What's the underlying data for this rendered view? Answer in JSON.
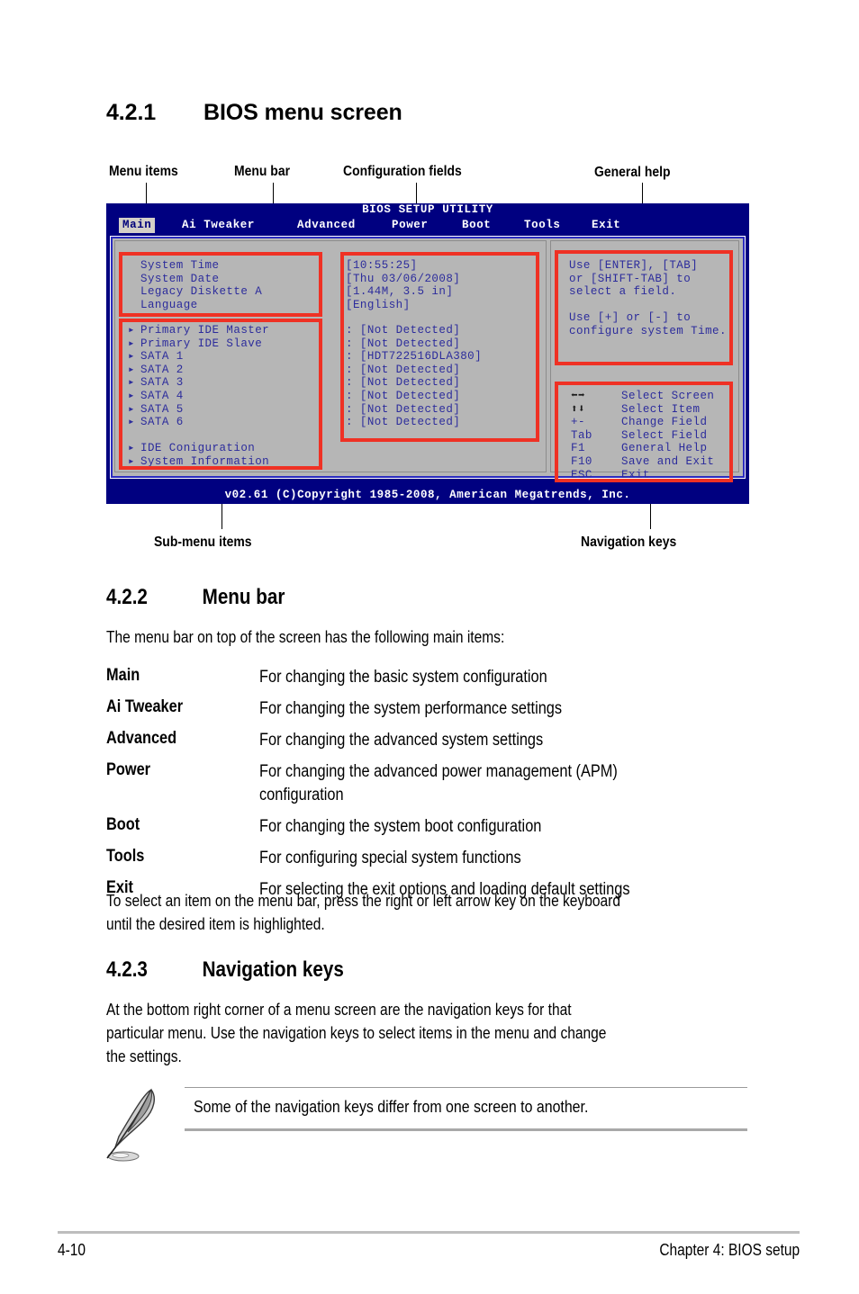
{
  "section_421": {
    "number": "4.2.1",
    "title": "BIOS menu screen"
  },
  "callouts": {
    "menu_items": "Menu items",
    "menu_bar": "Menu bar",
    "configuration_fields": "Configuration fields",
    "general_help": "General help",
    "sub_menu_items": "Sub-menu items",
    "navigation_keys": "Navigation keys"
  },
  "bios": {
    "title": "BIOS SETUP UTILITY",
    "tabs": [
      {
        "label": "Main",
        "active": true
      },
      {
        "label": "Ai Tweaker",
        "active": false
      },
      {
        "label": "Advanced",
        "active": false
      },
      {
        "label": "Power",
        "active": false
      },
      {
        "label": "Boot",
        "active": false
      },
      {
        "label": "Tools",
        "active": false
      },
      {
        "label": "Exit",
        "active": false
      }
    ],
    "menu_items": [
      "System Time",
      "System Date",
      "Legacy Diskette A",
      "Language"
    ],
    "menu_values": [
      "[10:55:25]",
      "[Thu 03/06/2008]",
      "[1.44M, 3.5 in]",
      "[English]"
    ],
    "submenu_items": [
      "Primary IDE Master",
      "Primary IDE Slave",
      "SATA 1",
      "SATA 2",
      "SATA 3",
      "SATA 4",
      "SATA 5",
      "SATA 6"
    ],
    "submenu_values": [
      ": [Not Detected]",
      ": [Not Detected]",
      ": [HDT722516DLA380]",
      ": [Not Detected]",
      ": [Not Detected]",
      ": [Not Detected]",
      ": [Not Detected]",
      ": [Not Detected]"
    ],
    "submenu_items_extra": [
      "IDE Coniguration",
      "System Information"
    ],
    "general_help": "Use [ENTER], [TAB]\nor [SHIFT-TAB] to\nselect a field.\n\nUse [+] or [-] to\nconfigure system Time.",
    "nav_keys": [
      {
        "key": "←→",
        "action": "Select Screen"
      },
      {
        "key": "↑↓",
        "action": "Select Item"
      },
      {
        "key": "+-",
        "action": "Change Field"
      },
      {
        "key": "Tab",
        "action": "Select Field"
      },
      {
        "key": "F1",
        "action": "General Help"
      },
      {
        "key": "F10",
        "action": "Save and Exit"
      },
      {
        "key": "ESC",
        "action": "Exit"
      }
    ],
    "footer": "v02.61 (C)Copyright 1985-2008, American Megatrends, Inc.",
    "colors": {
      "chrome_blue": "#000080",
      "panel_gray": "#b6b6b6",
      "text_blue": "#2c2c9c",
      "annotation_red": "#ef3124"
    }
  },
  "section_422": {
    "number": "4.2.2",
    "title": "Menu bar",
    "intro": "The menu bar on top of the screen has the following main items:",
    "entries": [
      {
        "term": "Main",
        "desc": "For changing the basic system configuration"
      },
      {
        "term": "Ai Tweaker",
        "desc": "For changing the system performance settings"
      },
      {
        "term": "Advanced",
        "desc": "For changing the advanced system settings"
      },
      {
        "term": "Power",
        "desc": "For changing the advanced power management (APM)\nconfiguration"
      },
      {
        "term": "Boot",
        "desc": "For changing the system boot configuration"
      },
      {
        "term": "Tools",
        "desc": "For configuring special system functions"
      },
      {
        "term": "Exit",
        "desc": "For selecting the exit options and loading default settings"
      }
    ],
    "outro": "To select an item on the menu bar, press the right or left arrow key on the keyboard\nuntil the desired item is highlighted."
  },
  "section_423": {
    "number": "4.2.3",
    "title": "Navigation keys",
    "body": "At the bottom right corner of a menu screen are the navigation keys for that\nparticular menu. Use the navigation keys to select items in the menu and change\nthe settings."
  },
  "note": {
    "icon": "quill-pen-icon",
    "text": "Some of the navigation keys differ from one screen to another."
  },
  "page_footer": {
    "page_number": "4-10",
    "chapter": "Chapter 4: BIOS setup"
  }
}
